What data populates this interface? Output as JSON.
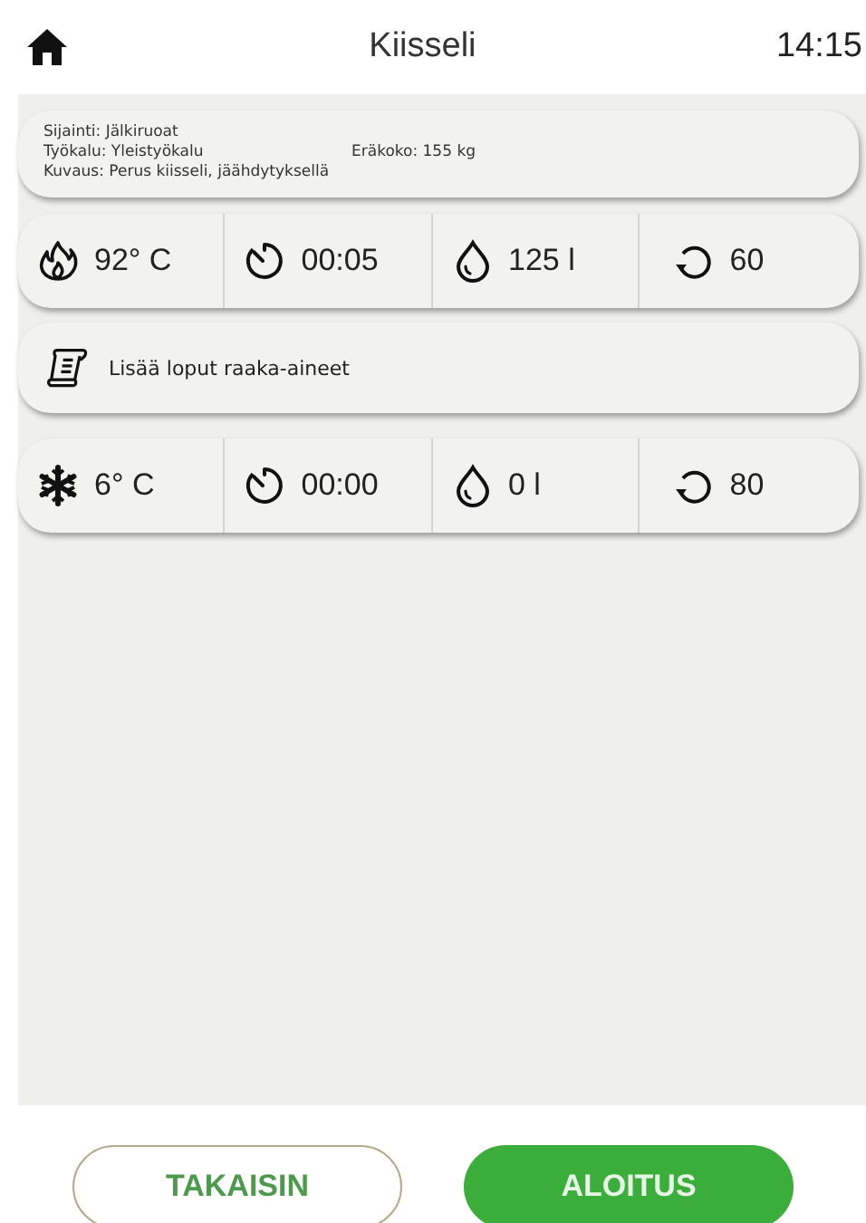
{
  "header": {
    "title": "Kiisseli",
    "time": "14:15"
  },
  "info": {
    "location": "Sijainti: Jälkiruoat",
    "tool": "Työkalu: Yleistyökalu",
    "batch": "Eräkoko: 155 kg",
    "description": "Kuvaus: Perus kiisseli, jäähdytyksellä"
  },
  "steps": [
    {
      "kind": "process",
      "temperature": {
        "kind": "heat",
        "value": "92° C"
      },
      "time": "00:05",
      "water": "125 l",
      "speed": "60"
    },
    {
      "kind": "note",
      "text": "Lisää loput raaka-aineet"
    },
    {
      "kind": "process",
      "temperature": {
        "kind": "cool",
        "value": "6° C"
      },
      "time": "00:00",
      "water": "0 l",
      "speed": "80"
    }
  ],
  "buttons": {
    "back": "TAKAISIN",
    "start": "ALOITUS"
  }
}
